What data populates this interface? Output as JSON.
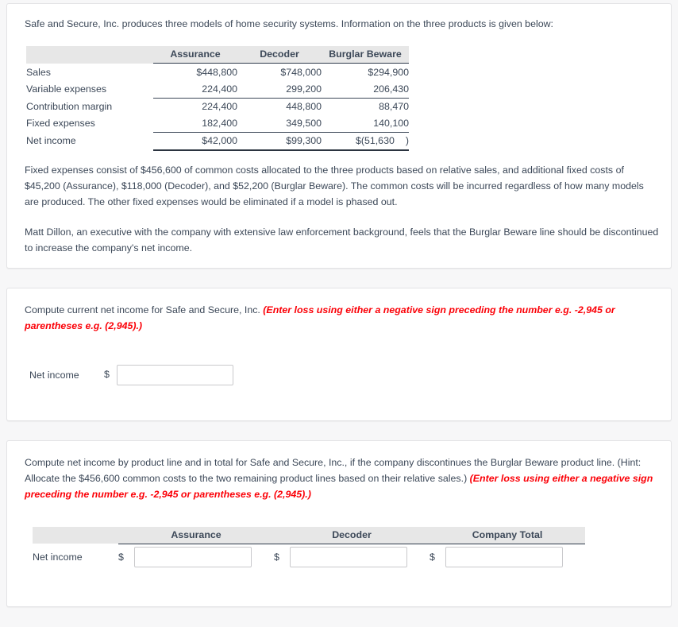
{
  "problem": {
    "intro": "Safe and Secure, Inc. produces three models of home security systems. Information on the three products is given below:",
    "paragraph_1": "Fixed expenses consist of $456,600 of common costs allocated to the three products based on relative sales, and additional fixed costs of $45,200 (Assurance), $118,000 (Decoder), and $52,200 (Burglar Beware). The common costs will be incurred regardless of how many models are produced. The other fixed expenses would be eliminated if a model is phased out.",
    "paragraph_2": "Matt Dillon, an executive with the company with extensive law enforcement background, feels that the Burglar Beware line should be discontinued to increase the company's net income."
  },
  "income_table": {
    "type": "table",
    "columns": [
      "",
      "Assurance",
      "Decoder",
      "Burglar Beware"
    ],
    "rows": [
      {
        "label": "Sales",
        "values": [
          "$448,800",
          "$748,000",
          "$294,900"
        ]
      },
      {
        "label": "Variable expenses",
        "values": [
          "224,400",
          "299,200",
          "206,430"
        ]
      },
      {
        "label": "Contribution margin",
        "values": [
          "224,400",
          "448,800",
          "88,470"
        ]
      },
      {
        "label": "Fixed expenses",
        "values": [
          "182,400",
          "349,500",
          "140,100"
        ]
      },
      {
        "label": "Net income",
        "values": [
          "$42,000",
          "$99,300",
          "$(51,630",
          "$(51,630  )"
        ]
      }
    ],
    "net_income_burglar_prefix": "$(51,630",
    "net_income_burglar_suffix": ")"
  },
  "requirement_1": {
    "prompt_plain": "Compute current net income for Safe and Secure, Inc. ",
    "prompt_red": "(Enter loss using either a negative sign preceding the number e.g. -2,945 or parentheses e.g. (2,945).)",
    "answer_label": "Net income",
    "dollar_sign": "$",
    "input_value": "",
    "input_placeholder": ""
  },
  "requirement_2": {
    "prompt_plain": "Compute net income by product line and in total for Safe and Secure, Inc., if the company discontinues the Burglar Beware product line. (Hint: Allocate the $456,600 common costs to the two remaining product lines based on their relative sales.) ",
    "prompt_red": "(Enter loss using either a negative sign preceding the number e.g. -2,945 or parentheses e.g. (2,945).)",
    "columns": [
      "",
      "Assurance",
      "Decoder",
      "Company Total"
    ],
    "row_label": "Net income",
    "dollar_sign": "$",
    "inputs": [
      {
        "name": "assurance",
        "value": "",
        "placeholder": ""
      },
      {
        "name": "decoder",
        "value": "",
        "placeholder": ""
      },
      {
        "name": "company-total",
        "value": "",
        "placeholder": ""
      }
    ]
  },
  "colors": {
    "text": "#3c4858",
    "emphasis_red": "#fb0007",
    "table_header_bg": "#e7e7e7",
    "card_border": "#e3e3e5",
    "page_bg": "#f7f7f8",
    "input_border": "#c9c9cc"
  }
}
